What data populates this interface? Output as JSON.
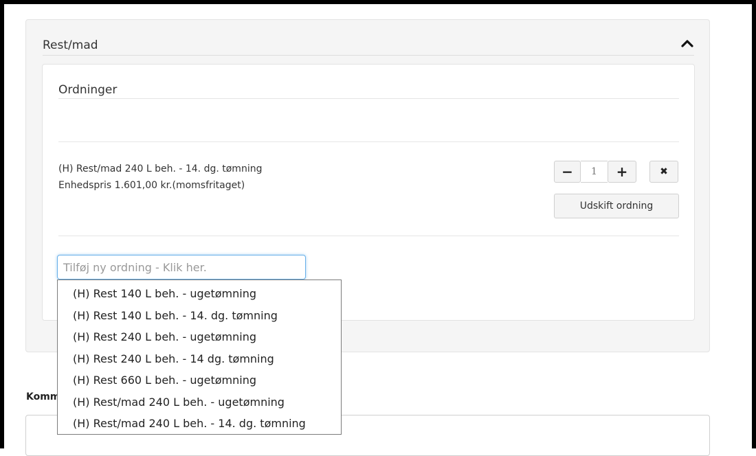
{
  "section": {
    "title": "Rest/mad"
  },
  "ordninger": {
    "title": "Ordninger",
    "items": [
      {
        "name": "(H) Rest/mad 240 L beh. - 14. dg. tømning",
        "price": "Enhedspris 1.601,00 kr.(momsfritaget)",
        "quantity": "1",
        "replace_label": "Udskift ordning"
      }
    ]
  },
  "add_input": {
    "placeholder": "Tilføj ny ordning - Klik her."
  },
  "dropdown": {
    "options": [
      "(H) Rest 140 L beh. - ugetømning",
      "(H) Rest 140 L beh. - 14. dg. tømning",
      "(H) Rest 240 L beh. - ugetømning",
      "(H) Rest 240 L beh. - 14 dg. tømning",
      "(H) Rest 660 L beh. - ugetømning",
      "(H) Rest/mad 240 L beh. - ugetømning",
      "(H) Rest/mad 240 L beh. - 14. dg. tømning"
    ]
  },
  "comment": {
    "label": "Komm"
  },
  "icons": {
    "collapse": "chevron-up-icon",
    "minus": "minus-icon",
    "plus": "plus-icon",
    "remove": "close-icon"
  },
  "colors": {
    "panel_bg": "#f5f5f5",
    "focus_border": "#66afe9",
    "button_bg": "#f4f4f4"
  }
}
